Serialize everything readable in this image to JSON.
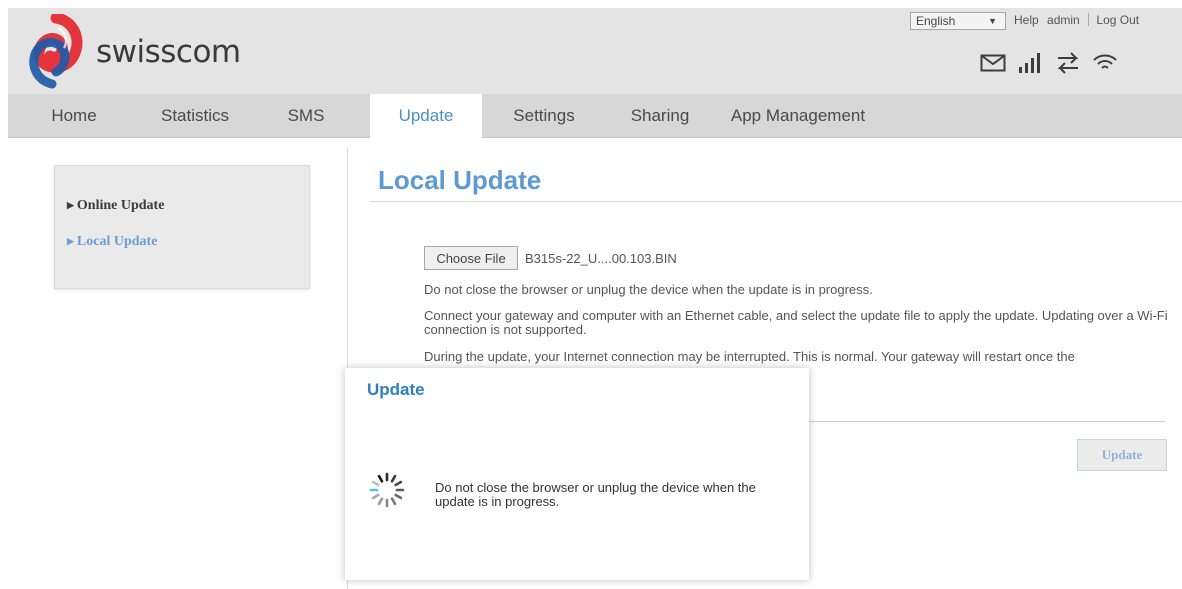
{
  "header": {
    "brand": "swisscom",
    "language": "English",
    "links": {
      "help": "Help",
      "user": "admin",
      "logout": "Log Out"
    },
    "icons": [
      "mail-icon",
      "signal-icon",
      "data-transfer-icon",
      "wifi-icon"
    ],
    "brand_colors": {
      "red": "#e3353b",
      "blue": "#1e5aa8"
    }
  },
  "nav": {
    "items": [
      {
        "id": "home",
        "label": "Home"
      },
      {
        "id": "statistics",
        "label": "Statistics"
      },
      {
        "id": "sms",
        "label": "SMS"
      },
      {
        "id": "update",
        "label": "Update",
        "active": true
      },
      {
        "id": "settings",
        "label": "Settings"
      },
      {
        "id": "sharing",
        "label": "Sharing"
      },
      {
        "id": "app-management",
        "label": "App Management"
      }
    ]
  },
  "sidebar": {
    "items": [
      {
        "id": "online-update",
        "label": "Online Update",
        "active": false
      },
      {
        "id": "local-update",
        "label": "Local Update",
        "active": true
      }
    ]
  },
  "main": {
    "title": "Local Update",
    "choose_file_label": "Choose File",
    "file_name": "B315s-22_U....00.103.BIN",
    "paragraphs": [
      "Do not close the browser or unplug the device when the update is in progress.",
      "Connect your gateway and computer with an Ethernet cable, and select the update file to apply the update. Updating over a Wi-Fi connection is not supported.",
      "During the update, your Internet connection may be interrupted. This is normal. Your gateway will restart once the"
    ],
    "update_button": "Update"
  },
  "modal": {
    "title": "Update",
    "message": "Do not close the browser or unplug the device when the update is in progress.",
    "spinner_icon": "loading-spinner-icon",
    "accent_color": "#2f7fbe"
  }
}
